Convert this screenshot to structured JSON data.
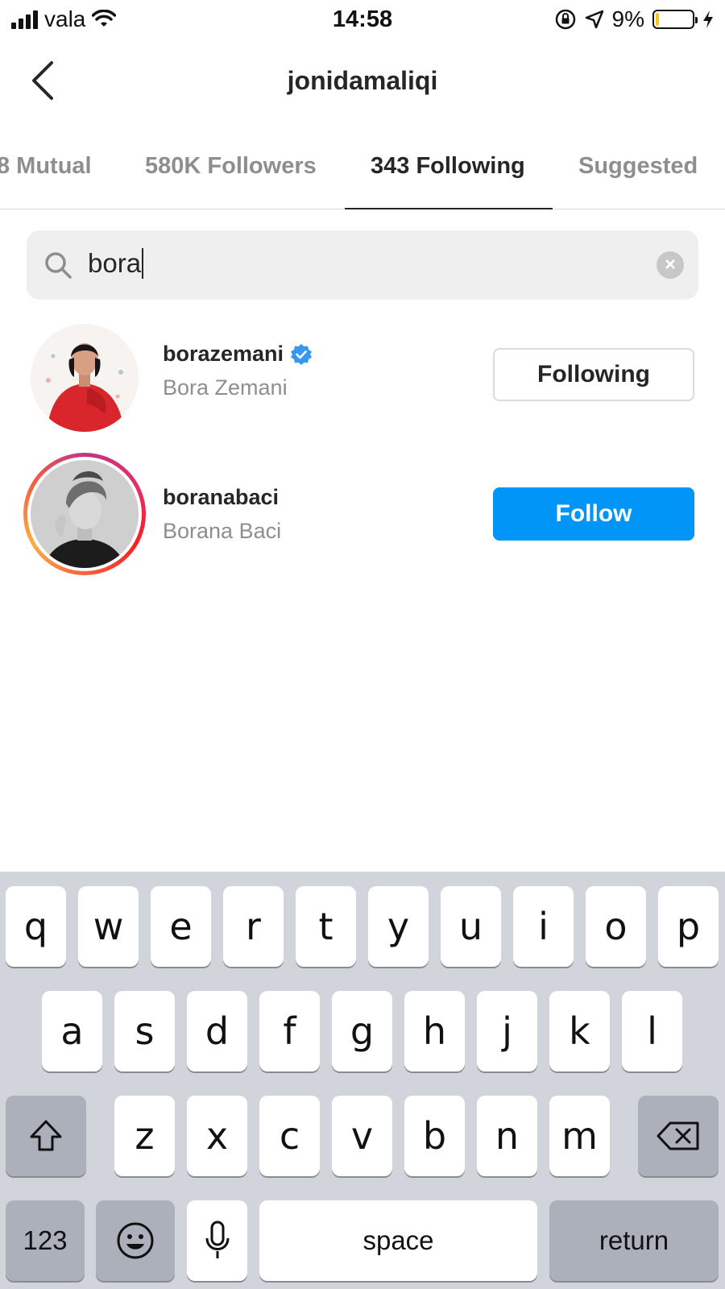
{
  "status_bar": {
    "carrier": "vala",
    "time": "14:58",
    "battery_percent": "9%",
    "battery_level": 0.09
  },
  "nav": {
    "title": "jonidamaliqi",
    "back_icon": "chevron-left-icon"
  },
  "tabs": [
    {
      "label": "8 Mutual",
      "active": false
    },
    {
      "label": "580K Followers",
      "active": false
    },
    {
      "label": "343 Following",
      "active": true
    },
    {
      "label": "Suggested",
      "active": false
    }
  ],
  "search": {
    "value": "bora",
    "icon": "search-icon",
    "clear_icon": "clear-icon"
  },
  "results": [
    {
      "username": "borazemani",
      "full_name": "Bora Zemani",
      "verified": true,
      "button": "Following",
      "story_ring": false
    },
    {
      "username": "boranabaci",
      "full_name": "Borana Baci",
      "verified": false,
      "button": "Follow",
      "story_ring": true
    }
  ],
  "keyboard": {
    "row1": [
      "q",
      "w",
      "e",
      "r",
      "t",
      "y",
      "u",
      "i",
      "o",
      "p"
    ],
    "row2": [
      "a",
      "s",
      "d",
      "f",
      "g",
      "h",
      "j",
      "k",
      "l"
    ],
    "row3": [
      "z",
      "x",
      "c",
      "v",
      "b",
      "n",
      "m"
    ],
    "numbers_key": "123",
    "space_key": "space",
    "return_key": "return"
  },
  "colors": {
    "accent": "#0095f6",
    "verified": "#3897f0",
    "keyboard_bg": "#d1d4db"
  }
}
